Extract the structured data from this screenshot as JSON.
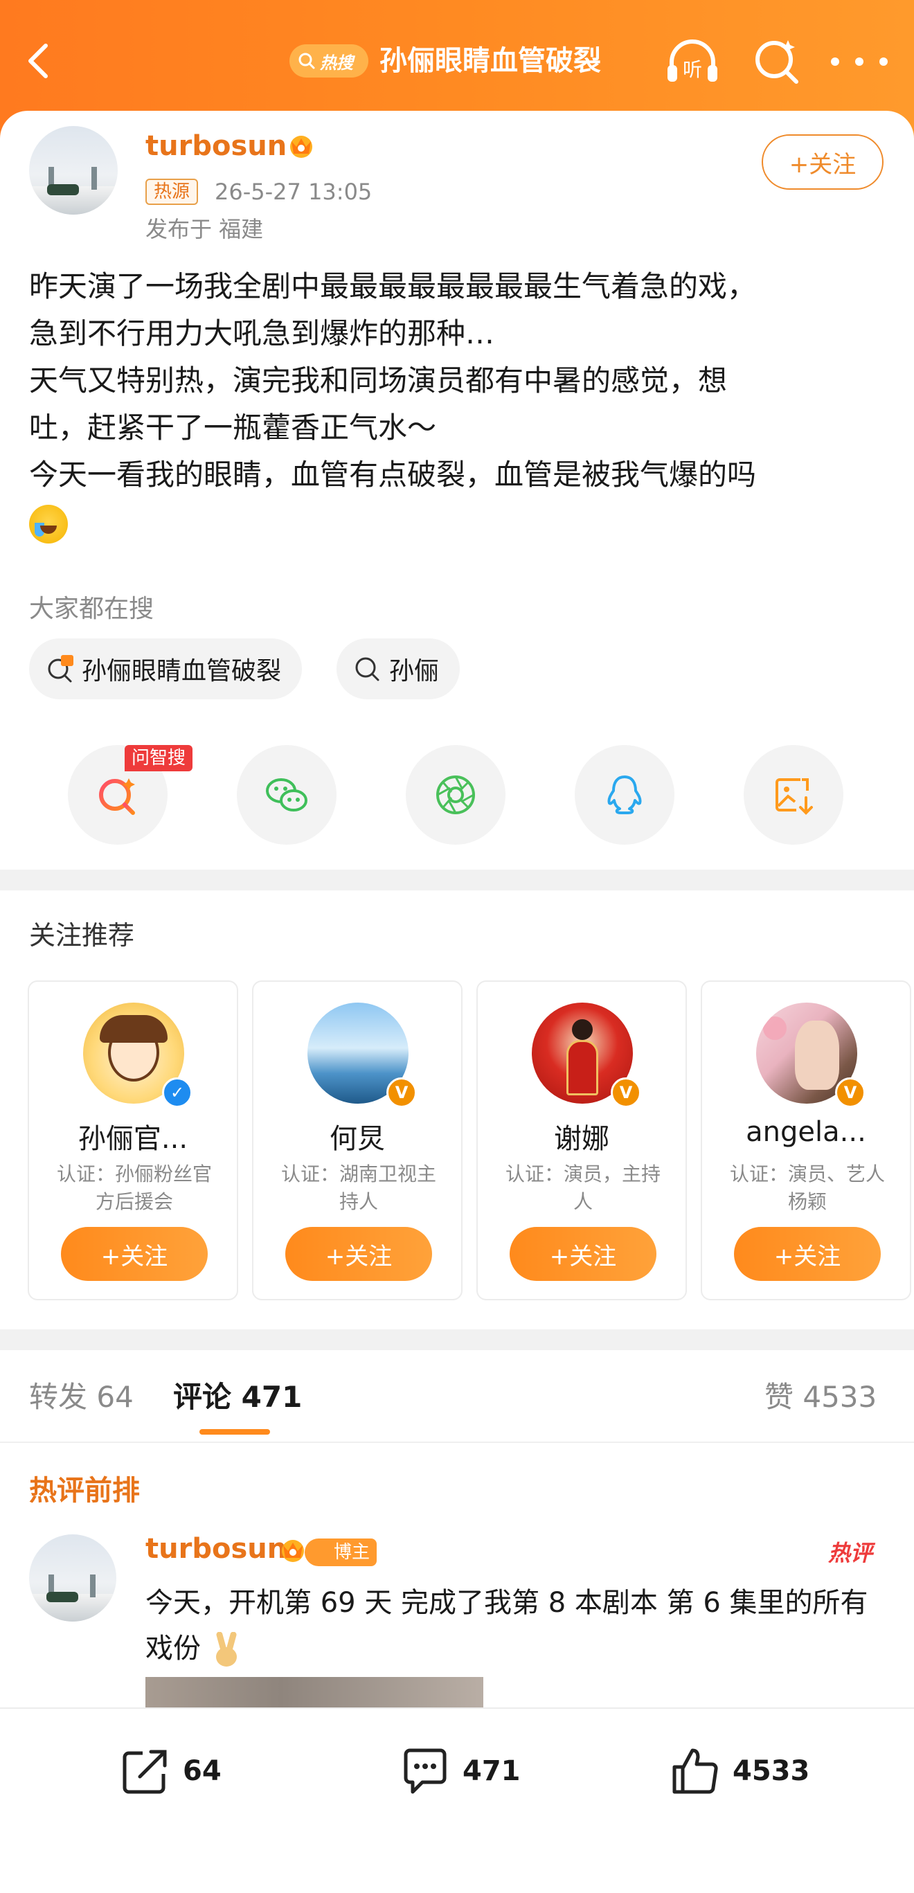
{
  "header": {
    "hot_label": "热搜",
    "title": "孙俪眼睛血管破裂",
    "listen_label": "听"
  },
  "post": {
    "author": "turbosun",
    "source_tag": "热源",
    "time": "26-5-27 13:05",
    "location": "发布于 福建",
    "follow_label": "+关注",
    "lines": [
      "昨天演了一场我全剧中最最最最最最最最生气着急的戏，",
      "急到不行用力大吼急到爆炸的那种…",
      "天气又特别热，演完我和同场演员都有中暑的感觉，想",
      "吐，赶紧干了一瓶藿香正气水～",
      "今天一看我的眼睛，血管有点破裂，血管是被我气爆的吗"
    ]
  },
  "search": {
    "title": "大家都在搜",
    "chips": [
      "孙俪眼睛血管破裂",
      "孙俪"
    ]
  },
  "share": {
    "ai_badge": "问智搜",
    "icons": [
      "ai-search-icon",
      "wechat-icon",
      "moments-icon",
      "qq-icon",
      "save-image-icon"
    ]
  },
  "recommend": {
    "title": "关注推荐",
    "follow_label": "+关注",
    "cards": [
      {
        "name": "孙俪官...",
        "cert": "认证：孙俪粉丝官方后援会",
        "badge_color": "#1e8cf0",
        "badge": "✓"
      },
      {
        "name": "何炅",
        "cert": "认证：湖南卫视主持人",
        "badge_color": "#f29000",
        "badge": "V"
      },
      {
        "name": "谢娜",
        "cert": "认证：演员，主持人",
        "badge_color": "#f29000",
        "badge": "V"
      },
      {
        "name": "angela...",
        "cert": "认证：演员、艺人杨颖",
        "badge_color": "#f29000",
        "badge": "V"
      }
    ]
  },
  "tabs": {
    "repost": "转发 64",
    "comment": "评论 471",
    "like": "赞 4533"
  },
  "comments": {
    "section_title": "热评前排",
    "first": {
      "author": "turbosun",
      "badge": "博主",
      "tag": "热评",
      "text": "今天，开机第 69 天 完成了我第 8 本剧本 第 6 集里的所有戏份"
    }
  },
  "bottom_bar": {
    "repost_count": "64",
    "comment_count": "471",
    "like_count": "4533"
  },
  "colors": {
    "brand_orange": "#ff8a1c",
    "name_orange": "#e8741a"
  }
}
